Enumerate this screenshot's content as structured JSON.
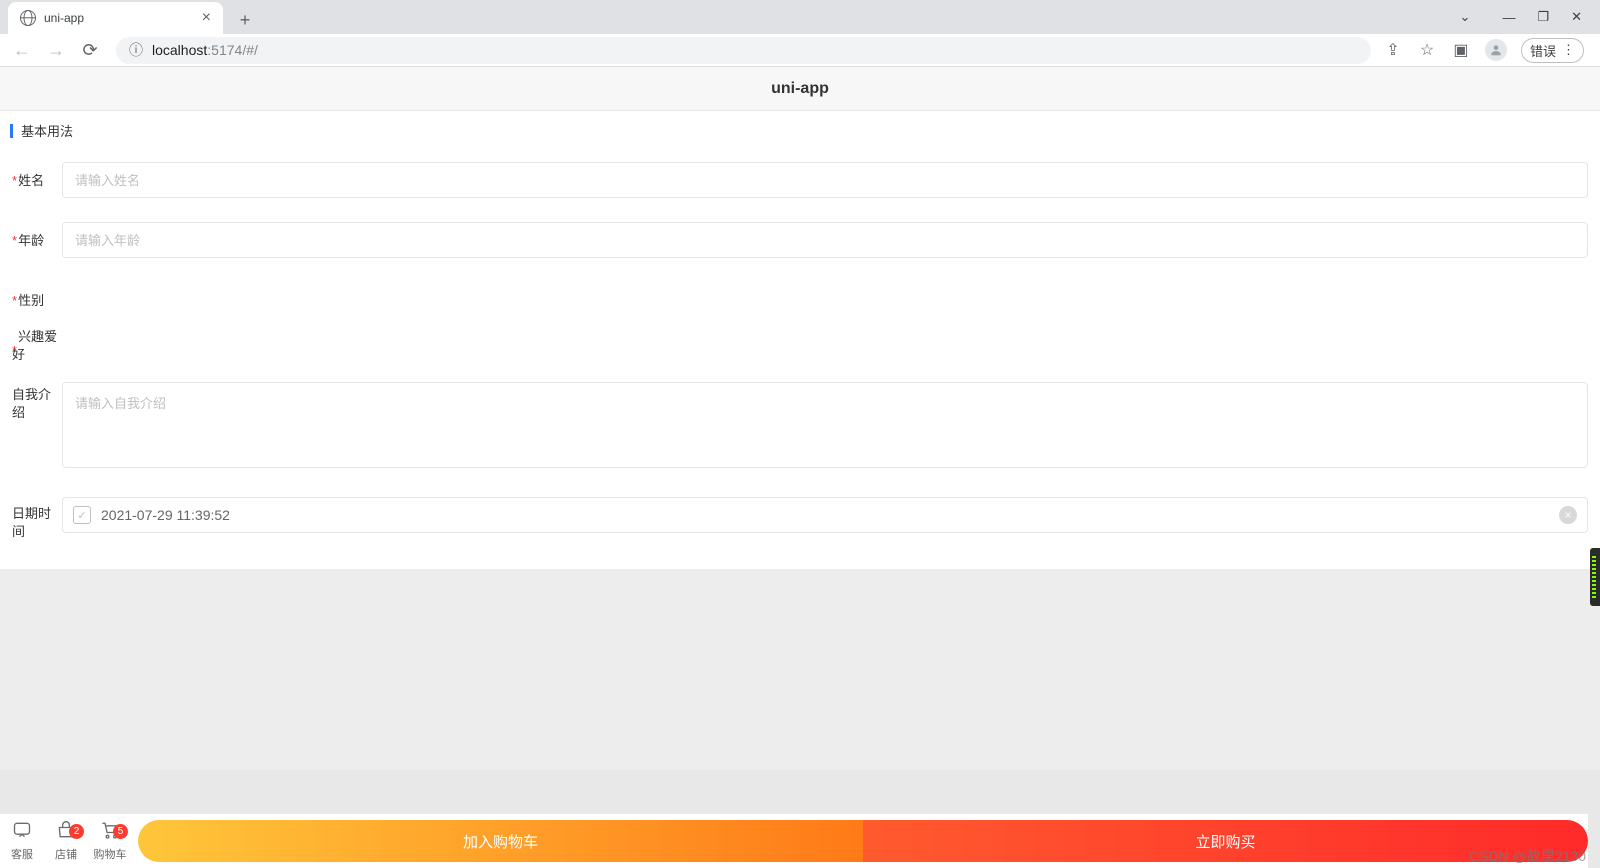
{
  "browser": {
    "tab_title": "uni-app",
    "url_host": "localhost",
    "url_port": ":5174",
    "url_path": "/#/",
    "error_pill": "错误"
  },
  "app": {
    "header_title": "uni-app",
    "section_title": "基本用法"
  },
  "form": {
    "name": {
      "label": "姓名",
      "required": true,
      "placeholder": "请输入姓名",
      "value": ""
    },
    "age": {
      "label": "年龄",
      "required": true,
      "placeholder": "请输入年龄",
      "value": ""
    },
    "gender": {
      "label": "性别",
      "required": true
    },
    "hobby": {
      "label": "兴趣爱好",
      "required": true
    },
    "intro": {
      "label": "自我介绍",
      "required": false,
      "placeholder": "请输入自我介绍",
      "value": ""
    },
    "datetime": {
      "label": "日期时间",
      "required": false,
      "value": "2021-07-29 11:39:52"
    }
  },
  "bottombar": {
    "service": {
      "label": "客服"
    },
    "shop": {
      "label": "店铺",
      "badge": "2"
    },
    "cart_icon": {
      "label": "购物车",
      "badge": "5"
    },
    "add_cart": "加入购物车",
    "buy_now": "立即购买"
  },
  "watermark": "CSDN @故里2130"
}
